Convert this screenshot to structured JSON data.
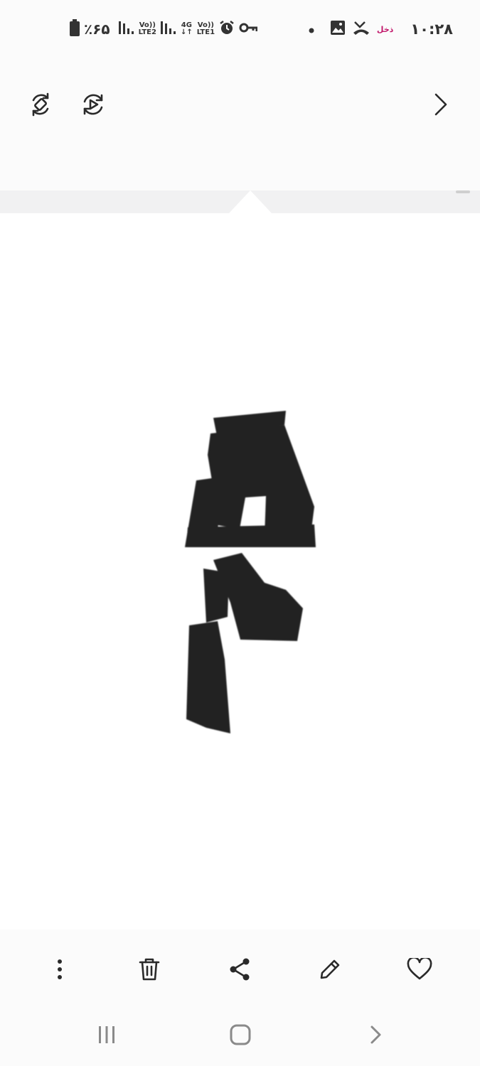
{
  "status_bar": {
    "clock": "۱۰:۲۸",
    "carrier_label": "ذخل",
    "battery_percent": "٪۶۵",
    "sim2_tag_top": "Vo))",
    "sim2_tag_bottom": "LTE2",
    "data_tag_top": "4G",
    "data_tag_bottom": "↓↑",
    "sim1_tag_top": "Vo))",
    "sim1_tag_bottom": "LTE1",
    "icons": [
      "battery-icon",
      "signal-icon",
      "signal-icon",
      "alarm-icon",
      "vpn-key-icon",
      "dot-icon",
      "gallery-icon",
      "missed-call-icon"
    ]
  },
  "top_bar": {
    "icons": [
      "auto-rotate-icon",
      "motion-photo-icon",
      "chevron-right-icon"
    ]
  },
  "viewer": {
    "image_subject": "calligraphy-glyph"
  },
  "bottom_toolbar": {
    "icons": [
      "more-options-icon",
      "delete-icon",
      "share-icon",
      "edit-icon",
      "favorite-icon"
    ]
  },
  "nav_bar": {
    "icons": [
      "recents-icon",
      "home-icon",
      "back-icon"
    ]
  },
  "colors": {
    "background": "#fbfbfb",
    "icon": "#2a2a2a",
    "carrier_accent": "#c2186b",
    "nav_icon": "#8a8a8a"
  }
}
